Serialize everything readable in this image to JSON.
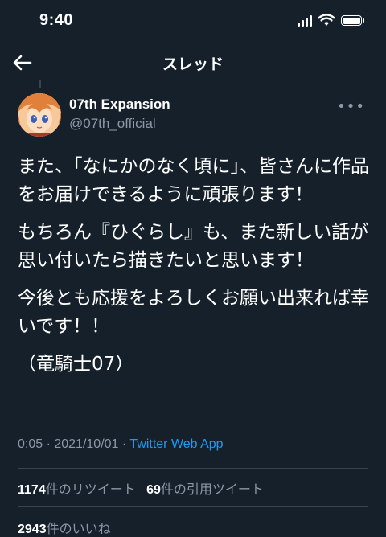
{
  "status_bar": {
    "time": "9:40"
  },
  "header": {
    "title": "スレッド"
  },
  "tweet": {
    "author_name": "07th Expansion",
    "author_handle": "@07th_official",
    "paragraphs": [
      "また、「なにかのなく頃に」、皆さんに作品をお届けできるように頑張ります！",
      "もちろん『ひぐらし』も、また新しい話が思い付いたら描きたいと思います！",
      "今後とも応援をよろしくお願い出来れば幸いです！！",
      "（竜騎士07）"
    ],
    "timestamp": "0:05 · 2021/10/01 · ",
    "source_app": "Twitter Web App",
    "retweets": "1174",
    "retweets_label": "件のリツイート",
    "quotes": "69",
    "quotes_label": "件の引用ツイート",
    "likes": "2943",
    "likes_label": "件のいいね"
  },
  "colors": {
    "background": "#15202b",
    "accent": "#1d9bf0",
    "secondary": "#8b98a5"
  }
}
